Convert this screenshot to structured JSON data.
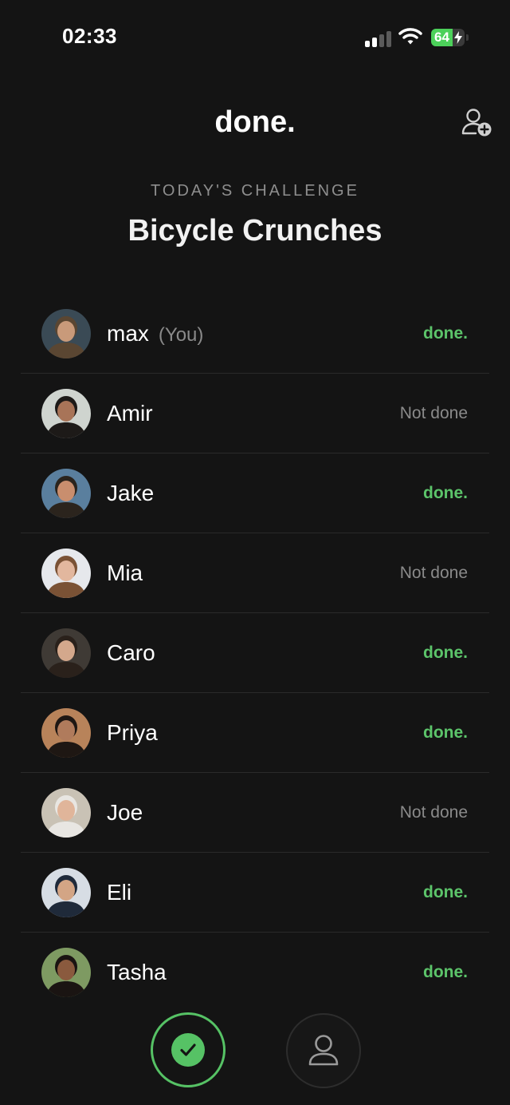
{
  "status_bar": {
    "time": "02:33",
    "battery_level": "64",
    "battery_fraction": 0.64,
    "icons": [
      "signal-icon",
      "wifi-icon",
      "battery-icon",
      "charging-bolt-icon"
    ]
  },
  "header": {
    "app_title": "done.",
    "add_friend_icon": "add-person-icon"
  },
  "challenge": {
    "label": "TODAY'S CHALLENGE",
    "name": "Bicycle Crunches"
  },
  "friends": [
    {
      "name": "max",
      "tag": "(You)",
      "status": "done.",
      "done": true,
      "avatar_bg": "#3a4a55",
      "skin": "#c99a7a",
      "hair": "#5a4632"
    },
    {
      "name": "Amir",
      "tag": "",
      "status": "Not done",
      "done": false,
      "avatar_bg": "#cfd4cf",
      "skin": "#a87458",
      "hair": "#1d1a18"
    },
    {
      "name": "Jake",
      "tag": "",
      "status": "done.",
      "done": true,
      "avatar_bg": "#5a7f9e",
      "skin": "#c98e6e",
      "hair": "#2b241d"
    },
    {
      "name": "Mia",
      "tag": "",
      "status": "Not done",
      "done": false,
      "avatar_bg": "#e6e8ec",
      "skin": "#e2b79e",
      "hair": "#7a5235"
    },
    {
      "name": "Caro",
      "tag": "",
      "status": "done.",
      "done": true,
      "avatar_bg": "#3f3a35",
      "skin": "#d4a88c",
      "hair": "#2a211b"
    },
    {
      "name": "Priya",
      "tag": "",
      "status": "done.",
      "done": true,
      "avatar_bg": "#b8835a",
      "skin": "#b07b5c",
      "hair": "#1e1713"
    },
    {
      "name": "Joe",
      "tag": "",
      "status": "Not done",
      "done": false,
      "avatar_bg": "#c9c2b5",
      "skin": "#e0b59a",
      "hair": "#e8e6e2"
    },
    {
      "name": "Eli",
      "tag": "",
      "status": "done.",
      "done": true,
      "avatar_bg": "#d7dde4",
      "skin": "#d3a585",
      "hair": "#1f2a3a"
    },
    {
      "name": "Tasha",
      "tag": "",
      "status": "done.",
      "done": true,
      "avatar_bg": "#7e9a62",
      "skin": "#8a5a3e",
      "hair": "#1a1412"
    }
  ],
  "tab_bar": {
    "active_tab_icon": "checkmark-icon",
    "profile_tab_icon": "person-icon"
  },
  "colors": {
    "background": "#141414",
    "accent_green": "#5cc46a",
    "muted_text": "#8a8a8a",
    "divider": "#2a2a2a"
  }
}
